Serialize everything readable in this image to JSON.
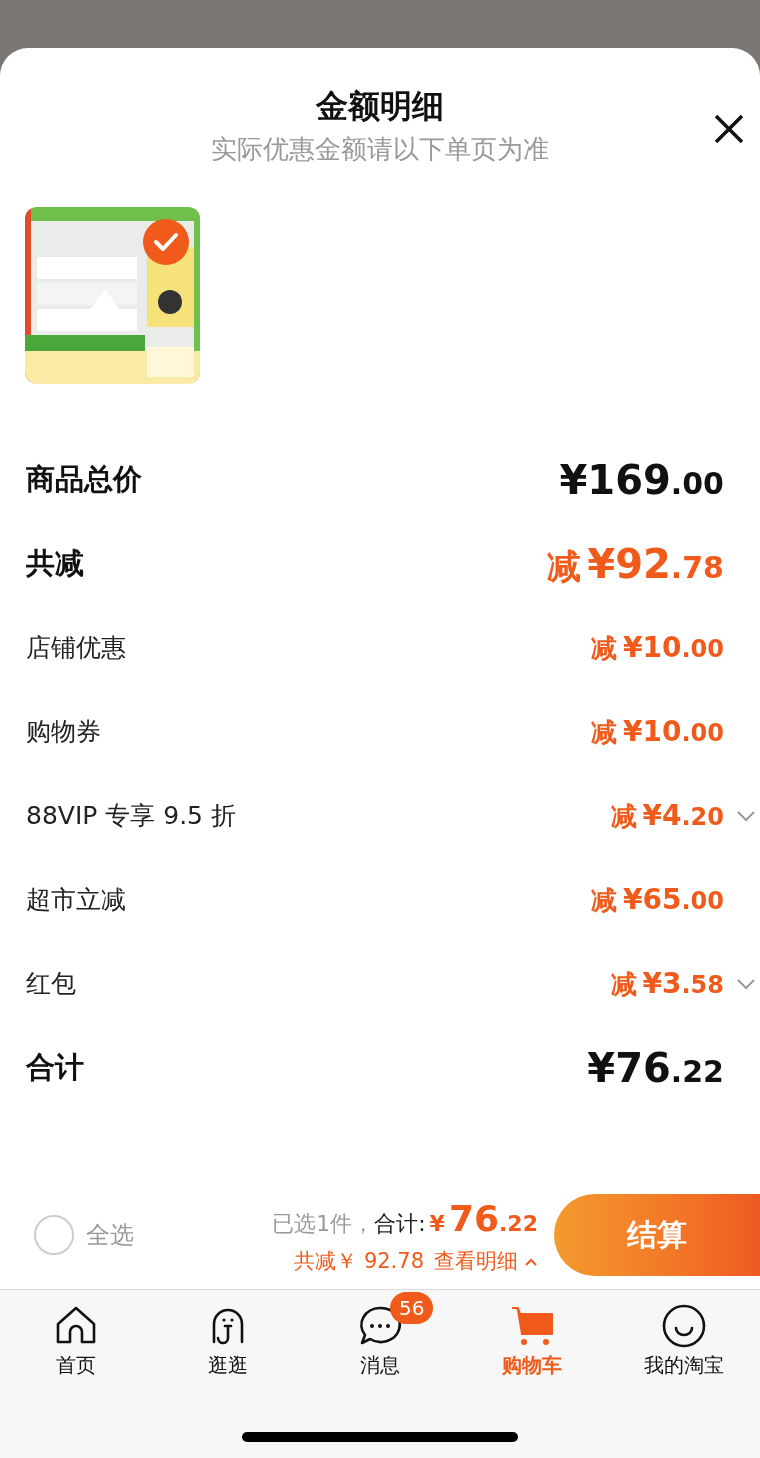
{
  "sheet": {
    "title": "金额明细",
    "subtitle": "实际优惠金额请以下单页为准"
  },
  "product": {
    "kind": "picture",
    "selected": true
  },
  "rows": [
    {
      "kind": "header",
      "label": "商品总价",
      "prefix": "",
      "amount": "¥169",
      "fraction": ".00",
      "expandable": false
    },
    {
      "kind": "discount_header",
      "label": "共减",
      "prefix": "减",
      "amount": "¥92",
      "fraction": ".78",
      "expandable": false
    },
    {
      "kind": "discount",
      "label": "店铺优惠",
      "prefix": "减",
      "amount": "¥10",
      "fraction": ".00",
      "expandable": false
    },
    {
      "kind": "discount",
      "label": "购物券",
      "prefix": "减",
      "amount": "¥10",
      "fraction": ".00",
      "expandable": false
    },
    {
      "kind": "discount",
      "label": "88VIP 专享 9.5 折",
      "prefix": "减",
      "amount": "¥4",
      "fraction": ".20",
      "expandable": true
    },
    {
      "kind": "discount",
      "label": "超市立减",
      "prefix": "减",
      "amount": "¥65",
      "fraction": ".00",
      "expandable": false
    },
    {
      "kind": "discount",
      "label": "红包",
      "prefix": "减",
      "amount": "¥3",
      "fraction": ".58",
      "expandable": true
    },
    {
      "kind": "header",
      "label": "合计",
      "prefix": "",
      "amount": "¥76",
      "fraction": ".22",
      "expandable": false
    }
  ],
  "checkout_bar": {
    "select_all": {
      "label": "全选",
      "checked": false
    },
    "selected_count": "已选1件，",
    "total_label": "合计:",
    "currency": "¥",
    "total": "76",
    "total_fraction": ".22",
    "saving": "共减￥ 92.78",
    "details_link": "查看明细",
    "details_expanded": true,
    "button": "结算"
  },
  "tab_bar": [
    {
      "label": "首页",
      "selected": false
    },
    {
      "label": "逛逛",
      "selected": false
    },
    {
      "label": "消息",
      "selected": false,
      "badge": "56"
    },
    {
      "label": "购物车",
      "selected": true
    },
    {
      "label": "我的淘宝",
      "selected": false
    }
  ]
}
